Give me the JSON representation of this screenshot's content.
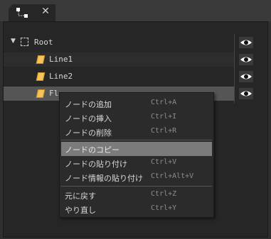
{
  "tab": {
    "icon": "node-graph-icon",
    "close_glyph": "✕"
  },
  "tree": {
    "rows": [
      {
        "label": "Root",
        "icon": "dashed-square-icon",
        "expander": "▼"
      },
      {
        "label": "Line1",
        "icon": "line-node-icon"
      },
      {
        "label": "Line2",
        "icon": "line-node-icon"
      },
      {
        "label": "Fl",
        "icon": "line-node-icon"
      }
    ]
  },
  "context_menu": {
    "items": [
      {
        "label": "ノードの追加",
        "shortcut": "Ctrl+A"
      },
      {
        "label": "ノードの挿入",
        "shortcut": "Ctrl+I"
      },
      {
        "label": "ノードの削除",
        "shortcut": "Ctrl+R"
      },
      {
        "label": "ノードのコピー",
        "shortcut": ""
      },
      {
        "label": "ノードの貼り付け",
        "shortcut": "Ctrl+V"
      },
      {
        "label": "ノード情報の貼り付け",
        "shortcut": "Ctrl+Alt+V"
      },
      {
        "label": "元に戻す",
        "shortcut": "Ctrl+Z"
      },
      {
        "label": "やり直し",
        "shortcut": "Ctrl+Y"
      }
    ],
    "highlighted": "ノードのコピー"
  },
  "colors": {
    "background": "#2f2f2f",
    "panel": "#262626",
    "menu": "#2b2b2b",
    "highlight": "#7b7b7b",
    "node_icon": "#f6c25a"
  }
}
